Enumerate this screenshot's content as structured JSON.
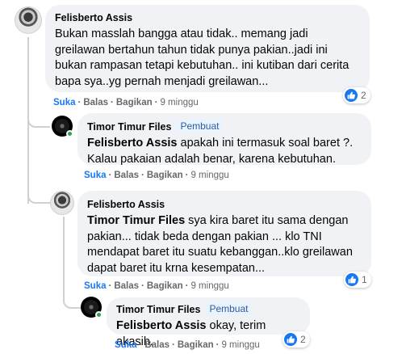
{
  "comments": [
    {
      "author": "Felisberto Assis",
      "body_lines": [
        "Bukan masslah bangga atau tidak.. memang jadi",
        "greilawan bertahun tahun tidak punya pakian..jadi ini",
        "bukan rampasan tetapi kebutuhan.. ini kutiban dari cerita",
        "bapa sya..yg pernah menjadi greilawan..."
      ],
      "reactions": "2",
      "actions": {
        "like": "Suka",
        "reply": "Balas",
        "share": "Bagikan",
        "time": "9 minggu"
      }
    },
    {
      "author": "Timor Timur Files",
      "badge": "Pembuat",
      "mention": "Felisberto Assis",
      "body_lines": [
        " apakah ini termasuk soal baret ?.",
        "Kalau pakaian adalah benar, karena kebutuhan."
      ],
      "actions": {
        "like": "Suka",
        "reply": "Balas",
        "share": "Bagikan",
        "time": "9 minggu"
      }
    },
    {
      "author": "Felisberto Assis",
      "mention": "Timor Timur Files",
      "body_lines": [
        " sya kira baret itu sama dengan",
        "pakian... tidak beda dengan pakian ... klo TNI",
        "mendapat baret itu suatu kebanggan..klo greilawan",
        "dapat baret itu krna kesempatan..."
      ],
      "reactions": "1",
      "actions": {
        "like": "Suka",
        "reply": "Balas",
        "share": "Bagikan",
        "time": "9 minggu"
      }
    },
    {
      "author": "Timor Timur Files",
      "badge": "Pembuat",
      "mention": "Felisberto Assis",
      "body_lines": [
        " okay, terim akasih."
      ],
      "reactions": "2",
      "actions": {
        "like": "Suka",
        "reply": "Balas",
        "share": "Bagikan",
        "time": "9 minggu"
      }
    }
  ],
  "colors": {
    "bubble": "#f0f2f5",
    "link": "#1877f2",
    "meta": "#65676b",
    "online": "#31a24c"
  }
}
